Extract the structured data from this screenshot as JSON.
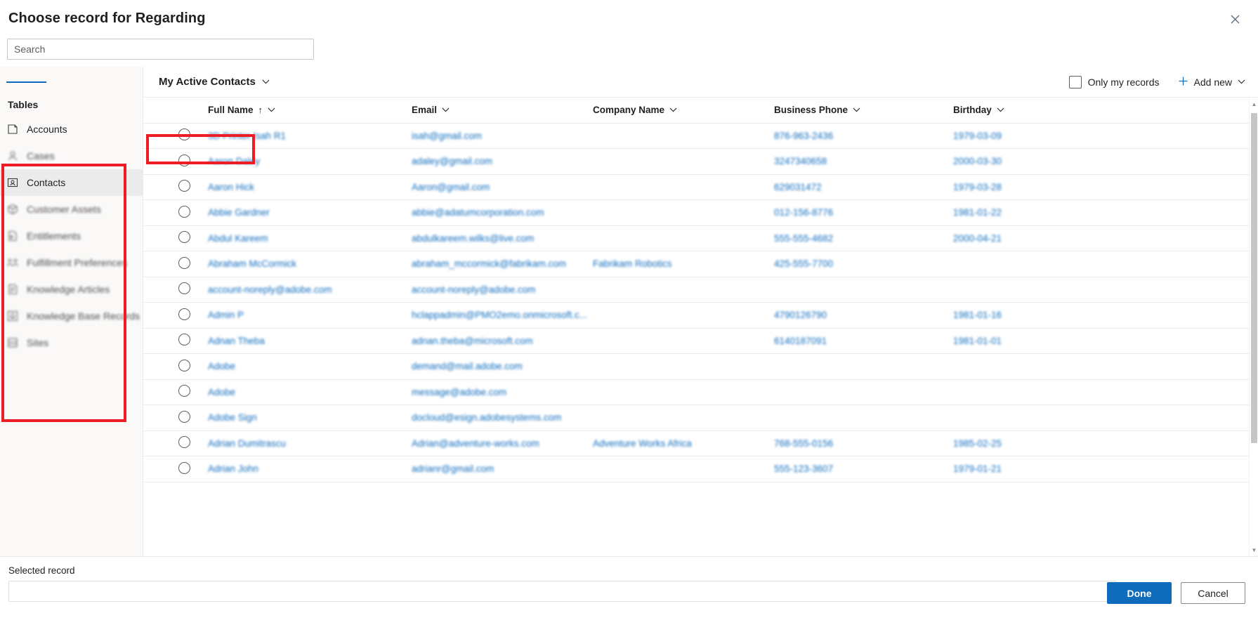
{
  "dialog": {
    "title": "Choose record for Regarding",
    "close_icon": "close-icon"
  },
  "search": {
    "placeholder": "Search",
    "value": ""
  },
  "sidebar": {
    "hamburger_icon": "hamburger-menu-icon",
    "header": "Tables",
    "items": [
      {
        "label": "Accounts",
        "icon": "account-icon",
        "selected": false,
        "blurred": false
      },
      {
        "label": "Cases",
        "icon": "case-person-icon",
        "selected": false,
        "blurred": true
      },
      {
        "label": "Contacts",
        "icon": "contact-card-icon",
        "selected": true,
        "blurred": false
      },
      {
        "label": "Customer Assets",
        "icon": "box-asset-icon",
        "selected": false,
        "blurred": true
      },
      {
        "label": "Entitlements",
        "icon": "entitlement-doc-icon",
        "selected": false,
        "blurred": true
      },
      {
        "label": "Fulfillment Preferences",
        "icon": "people-group-icon",
        "selected": false,
        "blurred": true
      },
      {
        "label": "Knowledge Articles",
        "icon": "article-page-icon",
        "selected": false,
        "blurred": true
      },
      {
        "label": "Knowledge Base Records",
        "icon": "knowledge-base-icon",
        "selected": false,
        "blurred": true
      },
      {
        "label": "Sites",
        "icon": "site-icon",
        "selected": false,
        "blurred": true
      }
    ]
  },
  "commandbar": {
    "view_name": "My Active Contacts",
    "view_chevron_icon": "chevron-down-icon",
    "only_my_records_label": "Only my records",
    "only_my_records_checked": false,
    "add_new_label": "Add new",
    "add_new_plus_icon": "plus-icon",
    "add_new_chevron_icon": "chevron-down-icon"
  },
  "grid": {
    "columns": [
      {
        "label": "",
        "key": "select"
      },
      {
        "label": "Full Name",
        "key": "fullname",
        "sorted": "asc",
        "sort_icon": "arrow-up-icon",
        "chevron_icon": "chevron-down-icon"
      },
      {
        "label": "Email",
        "key": "email",
        "chevron_icon": "chevron-down-icon"
      },
      {
        "label": "Company Name",
        "key": "company",
        "chevron_icon": "chevron-down-icon"
      },
      {
        "label": "Business Phone",
        "key": "phone",
        "chevron_icon": "chevron-down-icon"
      },
      {
        "label": "Birthday",
        "key": "birthday",
        "chevron_icon": "chevron-down-icon"
      }
    ],
    "rows": [
      {
        "fullname": "3D Printer Isah R1",
        "email": "isah@gmail.com",
        "company": "",
        "phone": "876-963-2436",
        "birthday": "1979-03-09"
      },
      {
        "fullname": "Aaron Daley",
        "email": "adaley@gmail.com",
        "company": "",
        "phone": "3247340658",
        "birthday": "2000-03-30"
      },
      {
        "fullname": "Aaron Hick",
        "email": "Aaron@gmail.com",
        "company": "",
        "phone": "629031472",
        "birthday": "1979-03-28"
      },
      {
        "fullname": "Abbie Gardner",
        "email": "abbie@adatumcorporation.com",
        "company": "",
        "phone": "012-156-8776",
        "birthday": "1981-01-22"
      },
      {
        "fullname": "Abdul Kareem",
        "email": "abdulkareem.wilks@live.com",
        "company": "",
        "phone": "555-555-4682",
        "birthday": "2000-04-21"
      },
      {
        "fullname": "Abraham McCormick",
        "email": "abraham_mccormick@fabrikam.com",
        "company": "Fabrikam Robotics",
        "phone": "425-555-7700",
        "birthday": ""
      },
      {
        "fullname": "account-noreply@adobe.com",
        "email": "account-noreply@adobe.com",
        "company": "",
        "phone": "",
        "birthday": ""
      },
      {
        "fullname": "Admin P",
        "email": "hclappadmin@PMO2emo.onmicrosoft.c...",
        "company": "",
        "phone": "4790126790",
        "birthday": "1981-01-16"
      },
      {
        "fullname": "Adnan Theba",
        "email": "adnan.theba@microsoft.com",
        "company": "",
        "phone": "6140187091",
        "birthday": "1981-01-01"
      },
      {
        "fullname": "Adobe",
        "email": "demand@mail.adobe.com",
        "company": "",
        "phone": "",
        "birthday": ""
      },
      {
        "fullname": "Adobe",
        "email": "message@adobe.com",
        "company": "",
        "phone": "",
        "birthday": ""
      },
      {
        "fullname": "Adobe Sign",
        "email": "docloud@esign.adobesystems.com",
        "company": "",
        "phone": "",
        "birthday": ""
      },
      {
        "fullname": "Adrian Dumitrascu",
        "email": "Adrian@adventure-works.com",
        "company": "Adventure Works Africa",
        "phone": "768-555-0156",
        "birthday": "1985-02-25"
      },
      {
        "fullname": "Adrian John",
        "email": "adrianr@gmail.com",
        "company": "",
        "phone": "555-123-3607",
        "birthday": "1979-01-21"
      }
    ]
  },
  "footer": {
    "selected_record_label": "Selected record",
    "selected_record_value": "",
    "done_label": "Done",
    "cancel_label": "Cancel"
  },
  "colors": {
    "accent": "#0f6cbd",
    "annotation": "#ee1c25",
    "selected_row_bg": "#ebebeb"
  }
}
